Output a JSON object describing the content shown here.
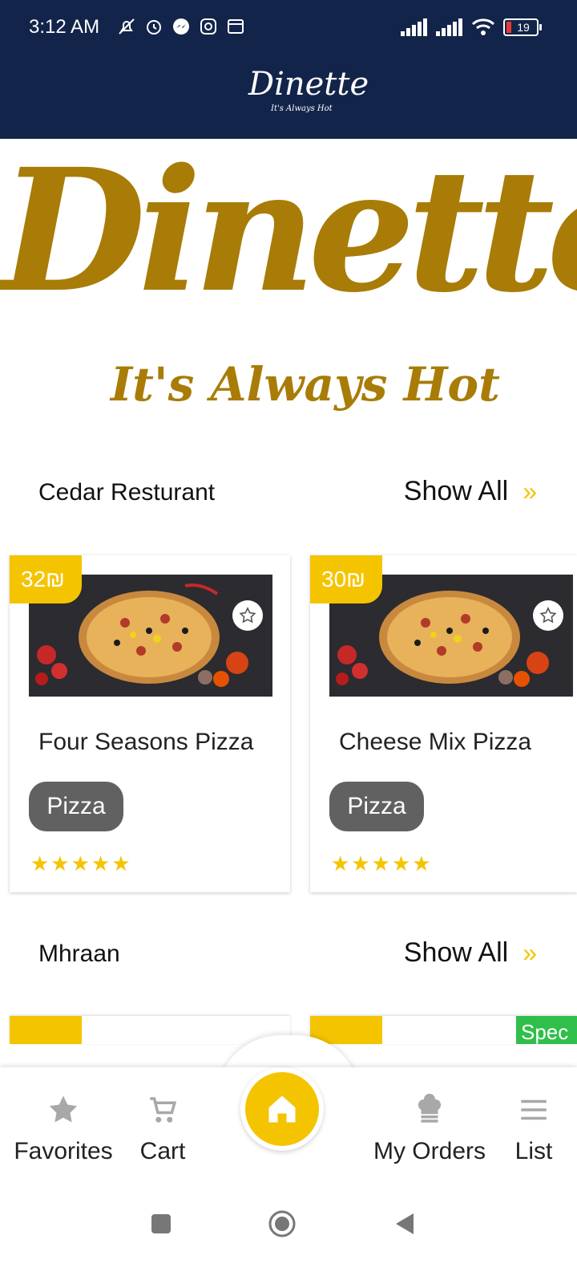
{
  "status_bar": {
    "time": "3:12 AM",
    "battery": "19"
  },
  "app_bar": {
    "logo": "Dinette",
    "tagline": "It's Always Hot"
  },
  "banner": {
    "title": "Dinette",
    "tagline": "It's Always Hot"
  },
  "sections": [
    {
      "title": "Cedar Resturant",
      "show_all": "Show All",
      "items": [
        {
          "price": "32₪",
          "name": "Four Seasons Pizza",
          "category": "Pizza",
          "rating": "★★★★★"
        },
        {
          "price": "30₪",
          "name": "Cheese Mix Pizza",
          "category": "Pizza",
          "rating": "★★★★★"
        }
      ]
    },
    {
      "title": "Mhraan",
      "show_all": "Show All",
      "special_label": "Spec"
    }
  ],
  "bottom_nav": {
    "favorites": "Favorites",
    "cart": "Cart",
    "my_orders": "My Orders",
    "list": "List"
  },
  "colors": {
    "navy": "#13244a",
    "gold": "#a87c07",
    "yellow": "#f5c400",
    "chip": "#616161",
    "special": "#2fbf4a"
  },
  "icons": [
    "bell-off-icon",
    "alarm-icon",
    "messenger-icon",
    "instagram-icon",
    "calendar-icon",
    "signal-icon",
    "wifi-icon",
    "battery-icon",
    "star-outline-icon",
    "chevron-double-right-icon",
    "star-icon",
    "cart-icon",
    "home-icon",
    "chef-icon",
    "menu-icon"
  ]
}
